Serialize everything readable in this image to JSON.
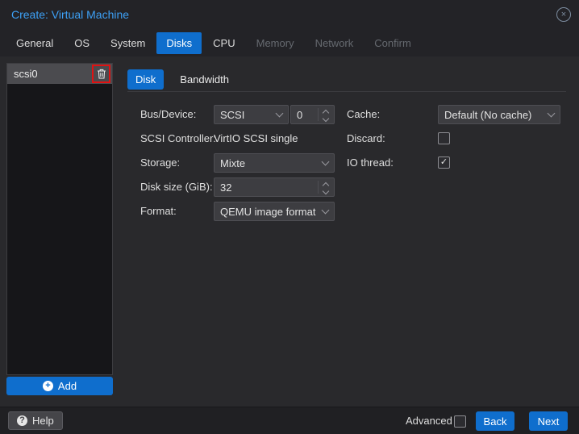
{
  "window": {
    "title": "Create: Virtual Machine"
  },
  "colors": {
    "accent_blue": "#0f6ecd",
    "title_blue": "#3da0f5",
    "annotation_red": "#e01212"
  },
  "icons": {
    "close": "×",
    "check": "✓",
    "plus": "+",
    "question": "?"
  },
  "tabs": [
    {
      "label": "General",
      "state": "normal"
    },
    {
      "label": "OS",
      "state": "normal"
    },
    {
      "label": "System",
      "state": "normal"
    },
    {
      "label": "Disks",
      "state": "active"
    },
    {
      "label": "CPU",
      "state": "normal"
    },
    {
      "label": "Memory",
      "state": "disabled"
    },
    {
      "label": "Network",
      "state": "disabled"
    },
    {
      "label": "Confirm",
      "state": "disabled"
    }
  ],
  "disk_panel": {
    "items": [
      {
        "label": "scsi0",
        "selected": true
      }
    ],
    "add_label": "Add"
  },
  "disk_tabs": [
    {
      "label": "Disk",
      "state": "active"
    },
    {
      "label": "Bandwidth",
      "state": "normal"
    }
  ],
  "form": {
    "bus_device": {
      "label": "Bus/Device:",
      "combo_value": "SCSI",
      "number_value": "0"
    },
    "cache": {
      "label": "Cache:",
      "value": "Default (No cache)"
    },
    "scsi_controller": {
      "label": "SCSI Controller:",
      "value": "VirtIO SCSI single"
    },
    "discard": {
      "label": "Discard:",
      "checked": false
    },
    "storage": {
      "label": "Storage:",
      "value": "Mixte"
    },
    "io_thread": {
      "label": "IO thread:",
      "checked": true
    },
    "disk_size": {
      "label": "Disk size (GiB):",
      "value": "32"
    },
    "format": {
      "label": "Format:",
      "value": "QEMU image format"
    }
  },
  "footer": {
    "help_label": "Help",
    "advanced_label": "Advanced",
    "advanced_checked": false,
    "back_label": "Back",
    "next_label": "Next"
  }
}
